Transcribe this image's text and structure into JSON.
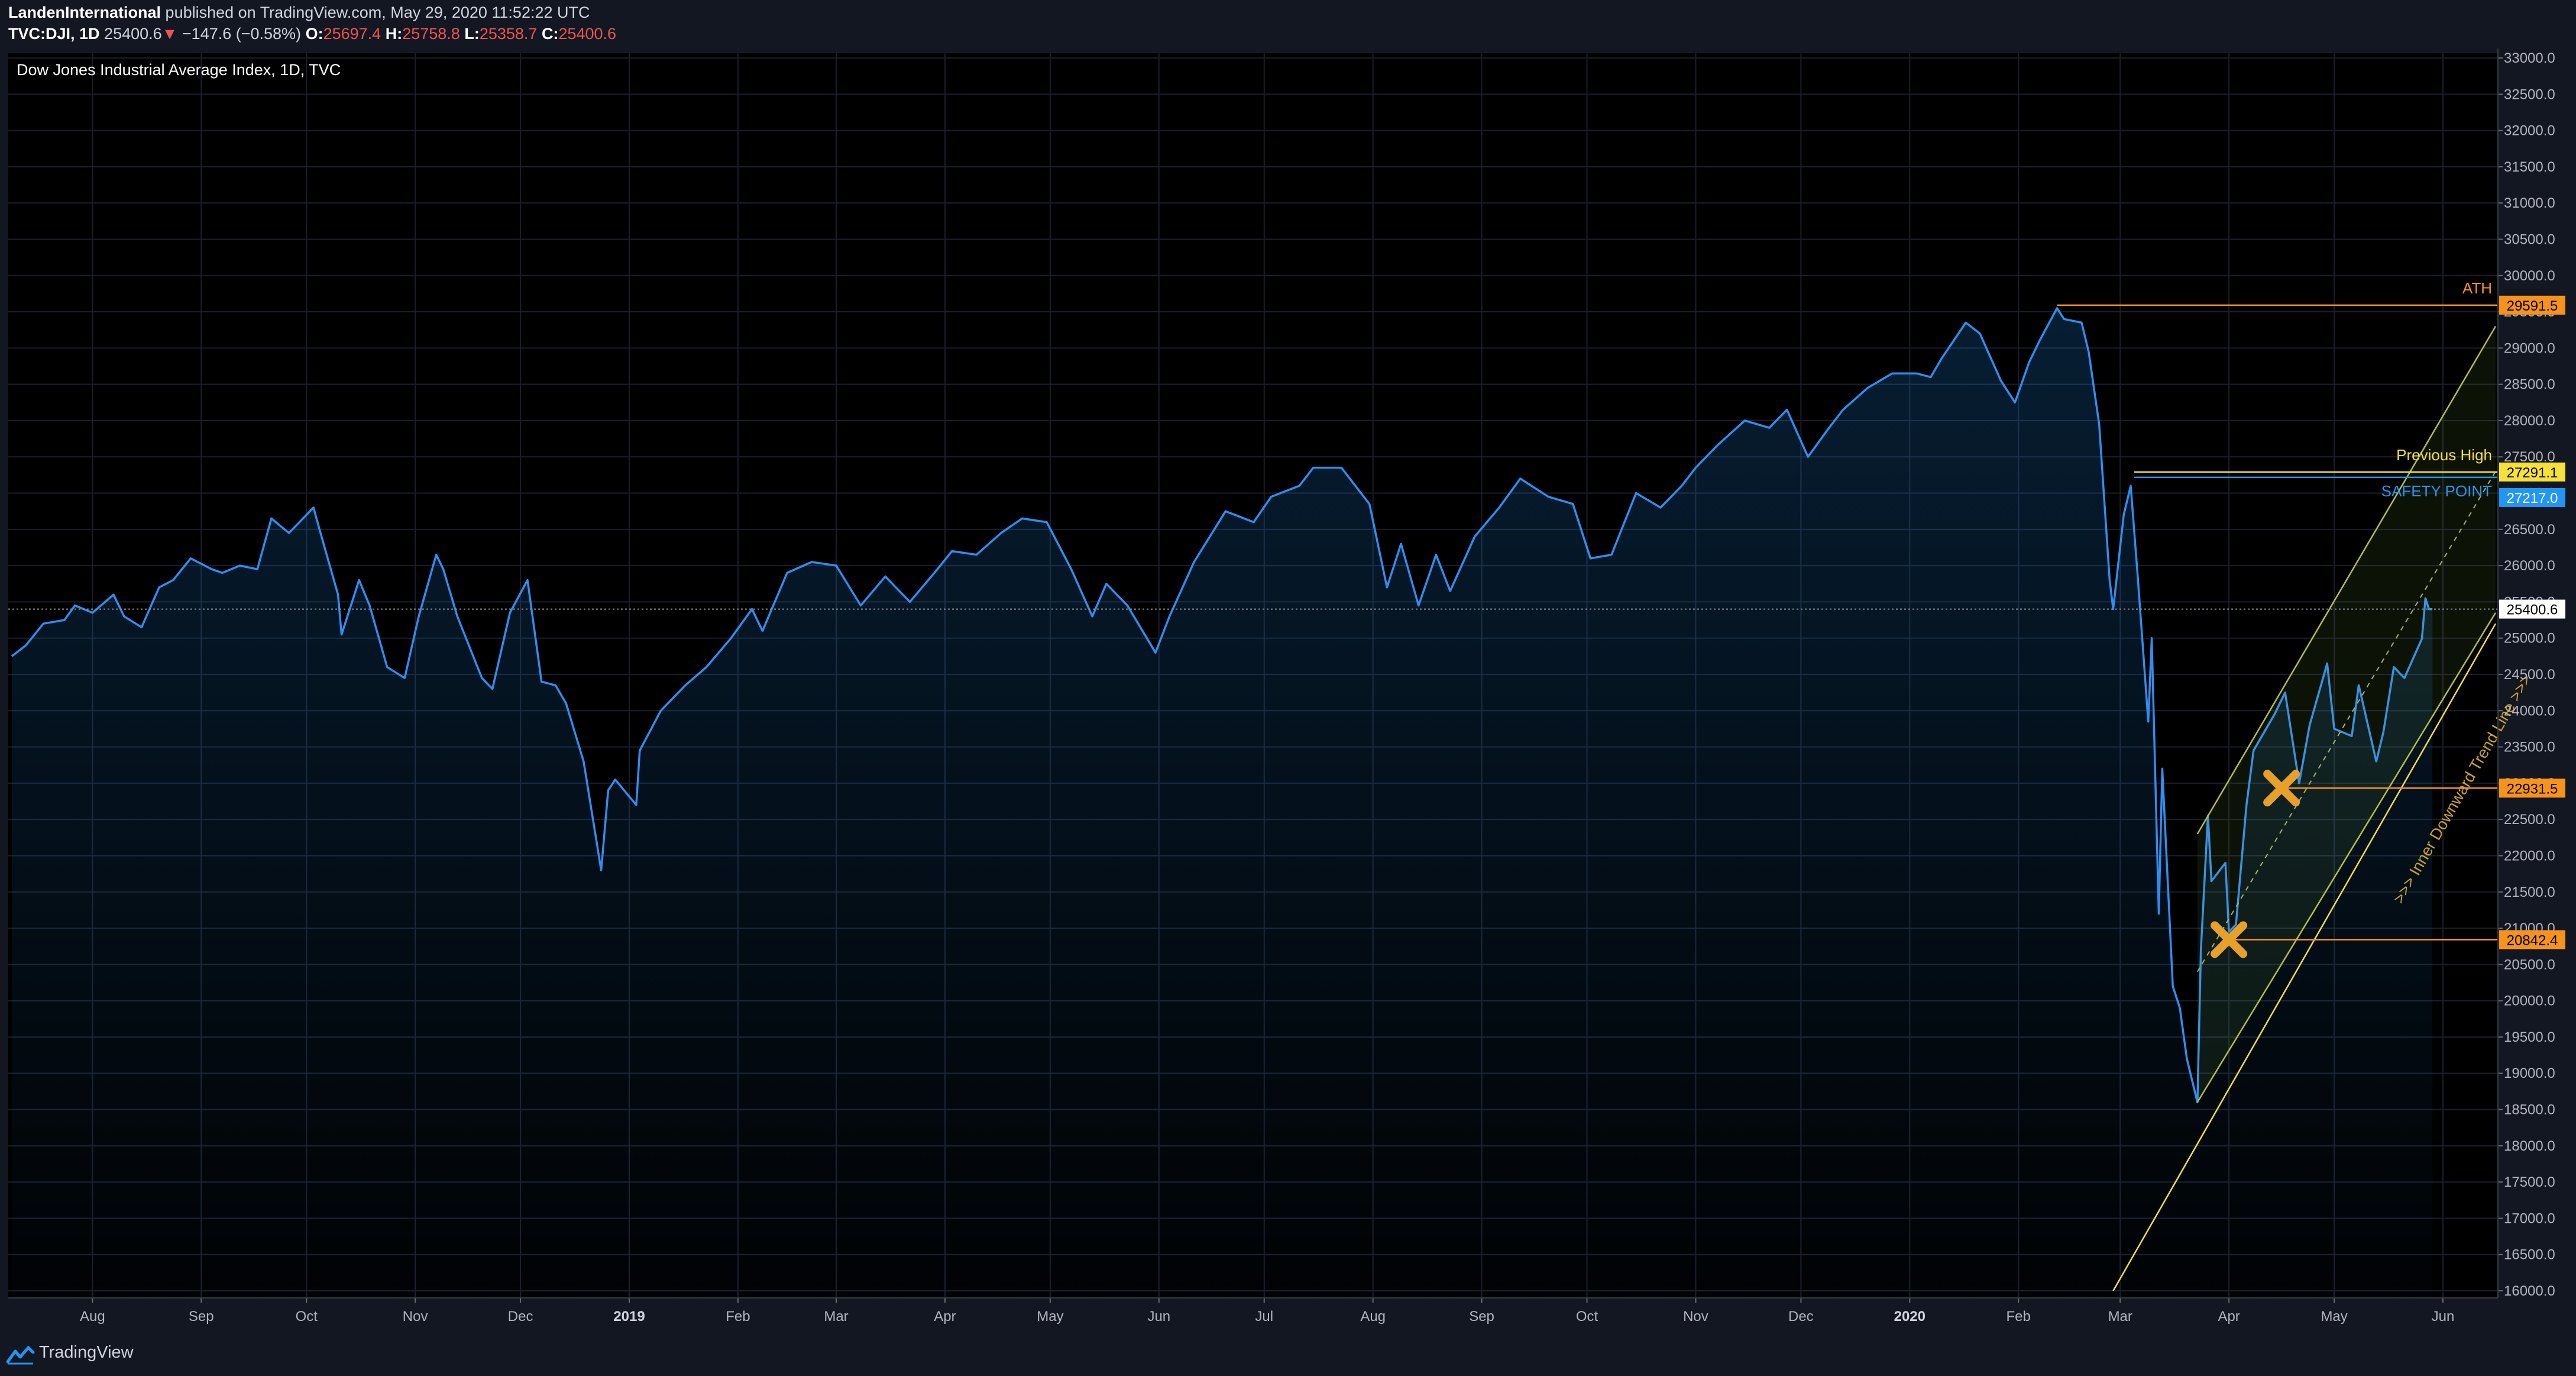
{
  "header": {
    "author": "LandenInternational",
    "published": "published on TradingView.com, May 29, 2020 11:52:22 UTC",
    "symbol": "TVC:DJI, 1D",
    "last": "25400.6",
    "down_arrow": "▼",
    "change": "−147.6 (−0.58%)",
    "o_label": "O:",
    "o_value": "25697.4",
    "h_label": "H:",
    "h_value": "25758.8",
    "l_label": "L:",
    "l_value": "25358.7",
    "c_label": "C:",
    "c_value": "25400.6"
  },
  "footer": {
    "brand": "TradingView",
    "logo_icon": "tradingview-logo-icon"
  },
  "colors": {
    "background": "#000000",
    "panel": "#131722",
    "line": "#2f8ef0",
    "ath": "#f7931a",
    "previous_high": "#f5e13a",
    "safety": "#2196f3",
    "channel": "#b5c142",
    "marker": "#e7a12a"
  },
  "chart_data": {
    "type": "area",
    "title": "Dow Jones Industrial Average Index, 1D, TVC",
    "ylim": [
      16000,
      33000
    ],
    "y_ticks": [
      "16000.0",
      "16500.0",
      "17000.0",
      "17500.0",
      "18000.0",
      "18500.0",
      "19000.0",
      "19500.0",
      "20000.0",
      "20500.0",
      "21000.0",
      "21500.0",
      "22000.0",
      "22500.0",
      "23000.0",
      "23500.0",
      "24000.0",
      "24500.0",
      "25000.0",
      "25500.0",
      "26000.0",
      "26500.0",
      "27000.0",
      "27500.0",
      "28000.0",
      "28500.0",
      "29000.0",
      "29500.0",
      "30000.0",
      "30500.0",
      "31000.0",
      "31500.0",
      "32000.0",
      "32500.0",
      "33000.0"
    ],
    "x_ticks": [
      {
        "label": "Aug",
        "date": "2018-08-01",
        "bold": false
      },
      {
        "label": "Sep",
        "date": "2018-09-01",
        "bold": false
      },
      {
        "label": "Oct",
        "date": "2018-10-01",
        "bold": false
      },
      {
        "label": "Nov",
        "date": "2018-11-01",
        "bold": false
      },
      {
        "label": "Dec",
        "date": "2018-12-01",
        "bold": false
      },
      {
        "label": "2019",
        "date": "2019-01-01",
        "bold": true
      },
      {
        "label": "Feb",
        "date": "2019-02-01",
        "bold": false
      },
      {
        "label": "Mar",
        "date": "2019-03-01",
        "bold": false
      },
      {
        "label": "Apr",
        "date": "2019-04-01",
        "bold": false
      },
      {
        "label": "May",
        "date": "2019-05-01",
        "bold": false
      },
      {
        "label": "Jun",
        "date": "2019-06-01",
        "bold": false
      },
      {
        "label": "Jul",
        "date": "2019-07-01",
        "bold": false
      },
      {
        "label": "Aug",
        "date": "2019-08-01",
        "bold": false
      },
      {
        "label": "Sep",
        "date": "2019-09-01",
        "bold": false
      },
      {
        "label": "Oct",
        "date": "2019-10-01",
        "bold": false
      },
      {
        "label": "Nov",
        "date": "2019-11-01",
        "bold": false
      },
      {
        "label": "Dec",
        "date": "2019-12-01",
        "bold": false
      },
      {
        "label": "2020",
        "date": "2020-01-01",
        "bold": true
      },
      {
        "label": "Feb",
        "date": "2020-02-01",
        "bold": false
      },
      {
        "label": "Mar",
        "date": "2020-03-01",
        "bold": false
      },
      {
        "label": "Apr",
        "date": "2020-04-01",
        "bold": false
      },
      {
        "label": "May",
        "date": "2020-05-01",
        "bold": false
      },
      {
        "label": "Jun",
        "date": "2020-06-01",
        "bold": false
      }
    ],
    "xlim": [
      "2018-07-08",
      "2020-06-16"
    ],
    "grid": true,
    "series": [
      {
        "values": [
          [
            "2018-07-09",
            24750
          ],
          [
            "2018-07-13",
            24900
          ],
          [
            "2018-07-18",
            25200
          ],
          [
            "2018-07-24",
            25250
          ],
          [
            "2018-07-27",
            25450
          ],
          [
            "2018-08-01",
            25350
          ],
          [
            "2018-08-07",
            25600
          ],
          [
            "2018-08-10",
            25300
          ],
          [
            "2018-08-15",
            25150
          ],
          [
            "2018-08-20",
            25700
          ],
          [
            "2018-08-24",
            25800
          ],
          [
            "2018-08-29",
            26100
          ],
          [
            "2018-09-04",
            25950
          ],
          [
            "2018-09-07",
            25900
          ],
          [
            "2018-09-12",
            26000
          ],
          [
            "2018-09-17",
            25950
          ],
          [
            "2018-09-21",
            26650
          ],
          [
            "2018-09-26",
            26450
          ],
          [
            "2018-10-03",
            26800
          ],
          [
            "2018-10-05",
            26450
          ],
          [
            "2018-10-10",
            25600
          ],
          [
            "2018-10-11",
            25050
          ],
          [
            "2018-10-16",
            25800
          ],
          [
            "2018-10-19",
            25450
          ],
          [
            "2018-10-24",
            24600
          ],
          [
            "2018-10-29",
            24450
          ],
          [
            "2018-11-02",
            25300
          ],
          [
            "2018-11-07",
            26150
          ],
          [
            "2018-11-09",
            25950
          ],
          [
            "2018-11-13",
            25300
          ],
          [
            "2018-11-20",
            24450
          ],
          [
            "2018-11-23",
            24300
          ],
          [
            "2018-11-28",
            25350
          ],
          [
            "2018-12-03",
            25800
          ],
          [
            "2018-12-07",
            24400
          ],
          [
            "2018-12-11",
            24350
          ],
          [
            "2018-12-14",
            24100
          ],
          [
            "2018-12-19",
            23300
          ],
          [
            "2018-12-24",
            21800
          ],
          [
            "2018-12-26",
            22900
          ],
          [
            "2018-12-28",
            23050
          ],
          [
            "2019-01-03",
            22700
          ],
          [
            "2019-01-04",
            23450
          ],
          [
            "2019-01-10",
            24000
          ],
          [
            "2019-01-17",
            24350
          ],
          [
            "2019-01-23",
            24600
          ],
          [
            "2019-01-30",
            25000
          ],
          [
            "2019-02-05",
            25400
          ],
          [
            "2019-02-08",
            25100
          ],
          [
            "2019-02-15",
            25900
          ],
          [
            "2019-02-22",
            26050
          ],
          [
            "2019-03-01",
            26000
          ],
          [
            "2019-03-08",
            25450
          ],
          [
            "2019-03-15",
            25850
          ],
          [
            "2019-03-22",
            25500
          ],
          [
            "2019-03-29",
            25900
          ],
          [
            "2019-04-03",
            26200
          ],
          [
            "2019-04-10",
            26150
          ],
          [
            "2019-04-17",
            26450
          ],
          [
            "2019-04-23",
            26650
          ],
          [
            "2019-04-30",
            26600
          ],
          [
            "2019-05-07",
            25950
          ],
          [
            "2019-05-13",
            25300
          ],
          [
            "2019-05-17",
            25750
          ],
          [
            "2019-05-23",
            25450
          ],
          [
            "2019-05-31",
            24800
          ],
          [
            "2019-06-04",
            25300
          ],
          [
            "2019-06-11",
            26050
          ],
          [
            "2019-06-20",
            26750
          ],
          [
            "2019-06-28",
            26600
          ],
          [
            "2019-07-03",
            26950
          ],
          [
            "2019-07-11",
            27100
          ],
          [
            "2019-07-15",
            27350
          ],
          [
            "2019-07-23",
            27350
          ],
          [
            "2019-07-31",
            26850
          ],
          [
            "2019-08-05",
            25700
          ],
          [
            "2019-08-09",
            26300
          ],
          [
            "2019-08-14",
            25450
          ],
          [
            "2019-08-19",
            26150
          ],
          [
            "2019-08-23",
            25650
          ],
          [
            "2019-08-30",
            26400
          ],
          [
            "2019-09-06",
            26800
          ],
          [
            "2019-09-12",
            27200
          ],
          [
            "2019-09-20",
            26950
          ],
          [
            "2019-09-27",
            26850
          ],
          [
            "2019-10-02",
            26100
          ],
          [
            "2019-10-08",
            26150
          ],
          [
            "2019-10-15",
            27000
          ],
          [
            "2019-10-22",
            26800
          ],
          [
            "2019-10-28",
            27100
          ],
          [
            "2019-11-01",
            27350
          ],
          [
            "2019-11-07",
            27650
          ],
          [
            "2019-11-15",
            28000
          ],
          [
            "2019-11-22",
            27900
          ],
          [
            "2019-11-27",
            28150
          ],
          [
            "2019-12-03",
            27500
          ],
          [
            "2019-12-09",
            27900
          ],
          [
            "2019-12-13",
            28150
          ],
          [
            "2019-12-20",
            28450
          ],
          [
            "2019-12-27",
            28650
          ],
          [
            "2020-01-03",
            28650
          ],
          [
            "2020-01-07",
            28600
          ],
          [
            "2020-01-10",
            28850
          ],
          [
            "2020-01-17",
            29350
          ],
          [
            "2020-01-21",
            29200
          ],
          [
            "2020-01-27",
            28550
          ],
          [
            "2020-01-31",
            28250
          ],
          [
            "2020-02-04",
            28800
          ],
          [
            "2020-02-07",
            29100
          ],
          [
            "2020-02-12",
            29550
          ],
          [
            "2020-02-14",
            29400
          ],
          [
            "2020-02-19",
            29350
          ],
          [
            "2020-02-21",
            28950
          ],
          [
            "2020-02-24",
            27950
          ],
          [
            "2020-02-27",
            25800
          ],
          [
            "2020-02-28",
            25400
          ],
          [
            "2020-03-02",
            26700
          ],
          [
            "2020-03-04",
            27100
          ],
          [
            "2020-03-06",
            25850
          ],
          [
            "2020-03-09",
            23850
          ],
          [
            "2020-03-10",
            25000
          ],
          [
            "2020-03-12",
            21200
          ],
          [
            "2020-03-13",
            23200
          ],
          [
            "2020-03-16",
            20200
          ],
          [
            "2020-03-18",
            19900
          ],
          [
            "2020-03-20",
            19200
          ],
          [
            "2020-03-23",
            18600
          ],
          [
            "2020-03-24",
            20700
          ],
          [
            "2020-03-26",
            22550
          ],
          [
            "2020-03-27",
            21650
          ],
          [
            "2020-03-31",
            21900
          ],
          [
            "2020-04-01",
            20950
          ],
          [
            "2020-04-03",
            21050
          ],
          [
            "2020-04-06",
            22700
          ],
          [
            "2020-04-08",
            23450
          ],
          [
            "2020-04-14",
            23950
          ],
          [
            "2020-04-17",
            24250
          ],
          [
            "2020-04-21",
            23000
          ],
          [
            "2020-04-24",
            23800
          ],
          [
            "2020-04-29",
            24650
          ],
          [
            "2020-05-01",
            23750
          ],
          [
            "2020-05-06",
            23650
          ],
          [
            "2020-05-08",
            24350
          ],
          [
            "2020-05-13",
            23300
          ],
          [
            "2020-05-15",
            23700
          ],
          [
            "2020-05-18",
            24600
          ],
          [
            "2020-05-21",
            24450
          ],
          [
            "2020-05-26",
            24990
          ],
          [
            "2020-05-27",
            25550
          ],
          [
            "2020-05-28",
            25400
          ],
          [
            "2020-05-29",
            25400
          ]
        ]
      }
    ],
    "horizontal_lines": [
      {
        "label": "ATH",
        "value": 29591.5,
        "tag": "29591.5",
        "start": "2020-02-12",
        "color": "#f7931a",
        "tag_text": "#000000"
      },
      {
        "label": "Previous High",
        "value": 27291.1,
        "tag": "27291.1",
        "start": "2020-03-05",
        "color": "#f5e13a",
        "tag_text": "#000000"
      },
      {
        "label": "SAFETY POINT",
        "value": 27217.0,
        "tag": "27217.0",
        "start": "2020-03-05",
        "color": "#2196f3",
        "tag_text": "#ffffff"
      },
      {
        "label": "",
        "value": 22931.5,
        "tag": "22931.5",
        "start": "2020-04-16",
        "color": "#f7931a",
        "tag_text": "#000000"
      },
      {
        "label": "",
        "value": 20842.4,
        "tag": "20842.4",
        "start": "2020-04-01",
        "color": "#f7931a",
        "tag_text": "#000000"
      }
    ],
    "last_price": {
      "value": 25400.6,
      "tag": "25400.6"
    },
    "channel": {
      "upper": [
        [
          "2020-03-23",
          22300
        ],
        [
          "2020-06-16",
          29300
        ]
      ],
      "lower": [
        [
          "2020-03-23",
          18600
        ],
        [
          "2020-06-16",
          25350
        ]
      ],
      "middle": [
        [
          "2020-03-23",
          20400
        ],
        [
          "2020-06-16",
          27300
        ]
      ],
      "outer_lower": [
        [
          "2020-02-28",
          16000
        ],
        [
          "2020-06-16",
          25200
        ]
      ],
      "annotation": ">>> Inner Downward Trend Line >>>"
    },
    "markers": [
      {
        "date": "2020-04-01",
        "value": 20842.4
      },
      {
        "date": "2020-04-16",
        "value": 22931.5
      }
    ]
  }
}
